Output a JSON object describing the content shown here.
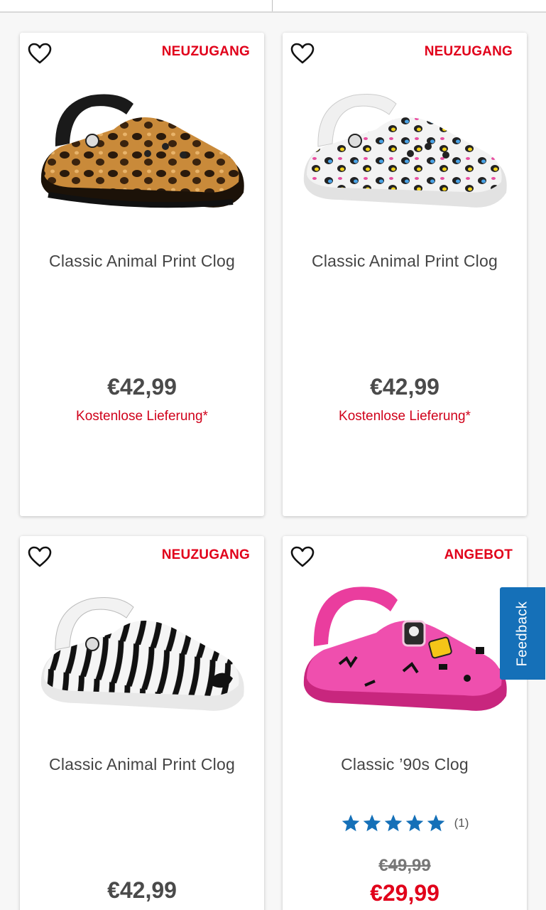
{
  "colors": {
    "badge_red": "#e1001a",
    "delivery_red": "#d0021b",
    "feedback_blue": "#1570b8",
    "star_blue": "#1570b8"
  },
  "products": [
    {
      "badge": "NEUZUGANG",
      "name": "Classic Animal Print Clog",
      "price": "€42,99",
      "delivery": "Kostenlose Lieferung*",
      "image": "leopard-brown-clog"
    },
    {
      "badge": "NEUZUGANG",
      "name": "Classic Animal Print Clog",
      "price": "€42,99",
      "delivery": "Kostenlose Lieferung*",
      "image": "leopard-multicolor-clog"
    },
    {
      "badge": "NEUZUGANG",
      "name": "Classic Animal Print Clog",
      "price": "€42,99",
      "image": "zebra-clog"
    },
    {
      "badge": "ANGEBOT",
      "name": "Classic ’90s Clog",
      "rating": 5,
      "review_count": "(1)",
      "old_price": "€49,99",
      "sale_price": "€29,99",
      "image": "pink-90s-clog"
    }
  ],
  "feedback": {
    "label": "Feedback"
  }
}
